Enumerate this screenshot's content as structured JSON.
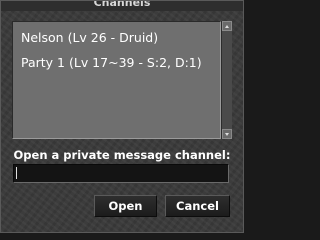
{
  "window": {
    "title": "Channels"
  },
  "channel_list": {
    "items": [
      {
        "label": "Nelson (Lv 26 - Druid)"
      },
      {
        "label": "Party 1 (Lv 17~39 - S:2, D:1)"
      }
    ]
  },
  "private_message": {
    "label": "Open a private message channel:",
    "value": ""
  },
  "buttons": {
    "open_label": "Open",
    "cancel_label": "Cancel"
  }
}
